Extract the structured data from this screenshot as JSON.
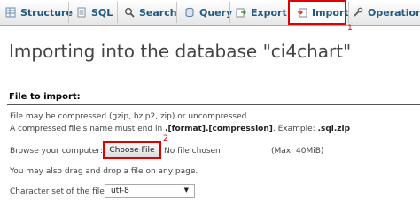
{
  "tabs": [
    {
      "label": "Structure",
      "icon": "structure-icon"
    },
    {
      "label": "SQL",
      "icon": "sql-icon"
    },
    {
      "label": "Search",
      "icon": "search-icon"
    },
    {
      "label": "Query",
      "icon": "query-icon"
    },
    {
      "label": "Export",
      "icon": "export-icon"
    },
    {
      "label": "Import",
      "icon": "import-icon",
      "active": true
    },
    {
      "label": "Operations",
      "icon": "operations-icon"
    }
  ],
  "markers": {
    "one": "1",
    "two": "2"
  },
  "page_title": "Importing into the database \"ci4chart\"",
  "section_title": "File to import:",
  "info_line1": "File may be compressed (gzip, bzip2, zip) or uncompressed.",
  "info_line2_prefix": "A compressed file's name must end in ",
  "info_line2_format": ".[format].[compression]",
  "info_line2_mid": ". Example: ",
  "info_line2_example": ".sql.zip",
  "browse_label": "Browse your computer:",
  "choose_file_label": "Choose File",
  "no_file_text": "No file chosen",
  "max_size": "(Max: 40MiB)",
  "drag_drop_text": "You may also drag and drop a file on any page.",
  "charset_label": "Character set of the file:",
  "charset_value": "utf-8",
  "colors": {
    "accent_red": "#e00000",
    "tab_text": "#235a81"
  }
}
